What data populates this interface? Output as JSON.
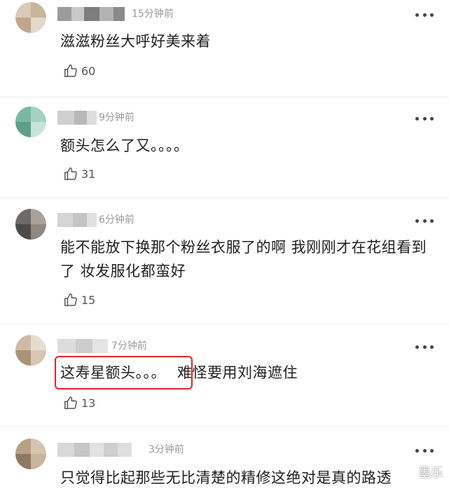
{
  "comments": [
    {
      "time": "15分钟前",
      "text": "滋滋粉丝大呼好美来着",
      "likes": "60"
    },
    {
      "time": "9分钟前",
      "text": "额头怎么了又。。。。",
      "likes": "31"
    },
    {
      "time": "6分钟前",
      "text": "能不能放下换那个粉丝衣服了的啊 我刚刚才在花组看到了 妆发服化都蛮好",
      "likes": "15"
    },
    {
      "time": "7分钟前",
      "text_highlighted": "这寿星额头。。。",
      "text_rest": "难怪要用刘海遮住",
      "likes": "13"
    },
    {
      "time": "3分钟前",
      "text": "只觉得比起那些无比清楚的精修这绝对是真的路透"
    }
  ],
  "watermark": "墨乐",
  "colors": {
    "highlight_border": "#e5262a",
    "time_gray": "#999999",
    "text": "#1f1f1f"
  },
  "icons": {
    "like": "thumbs-up-icon",
    "more": "more-dots-icon"
  }
}
